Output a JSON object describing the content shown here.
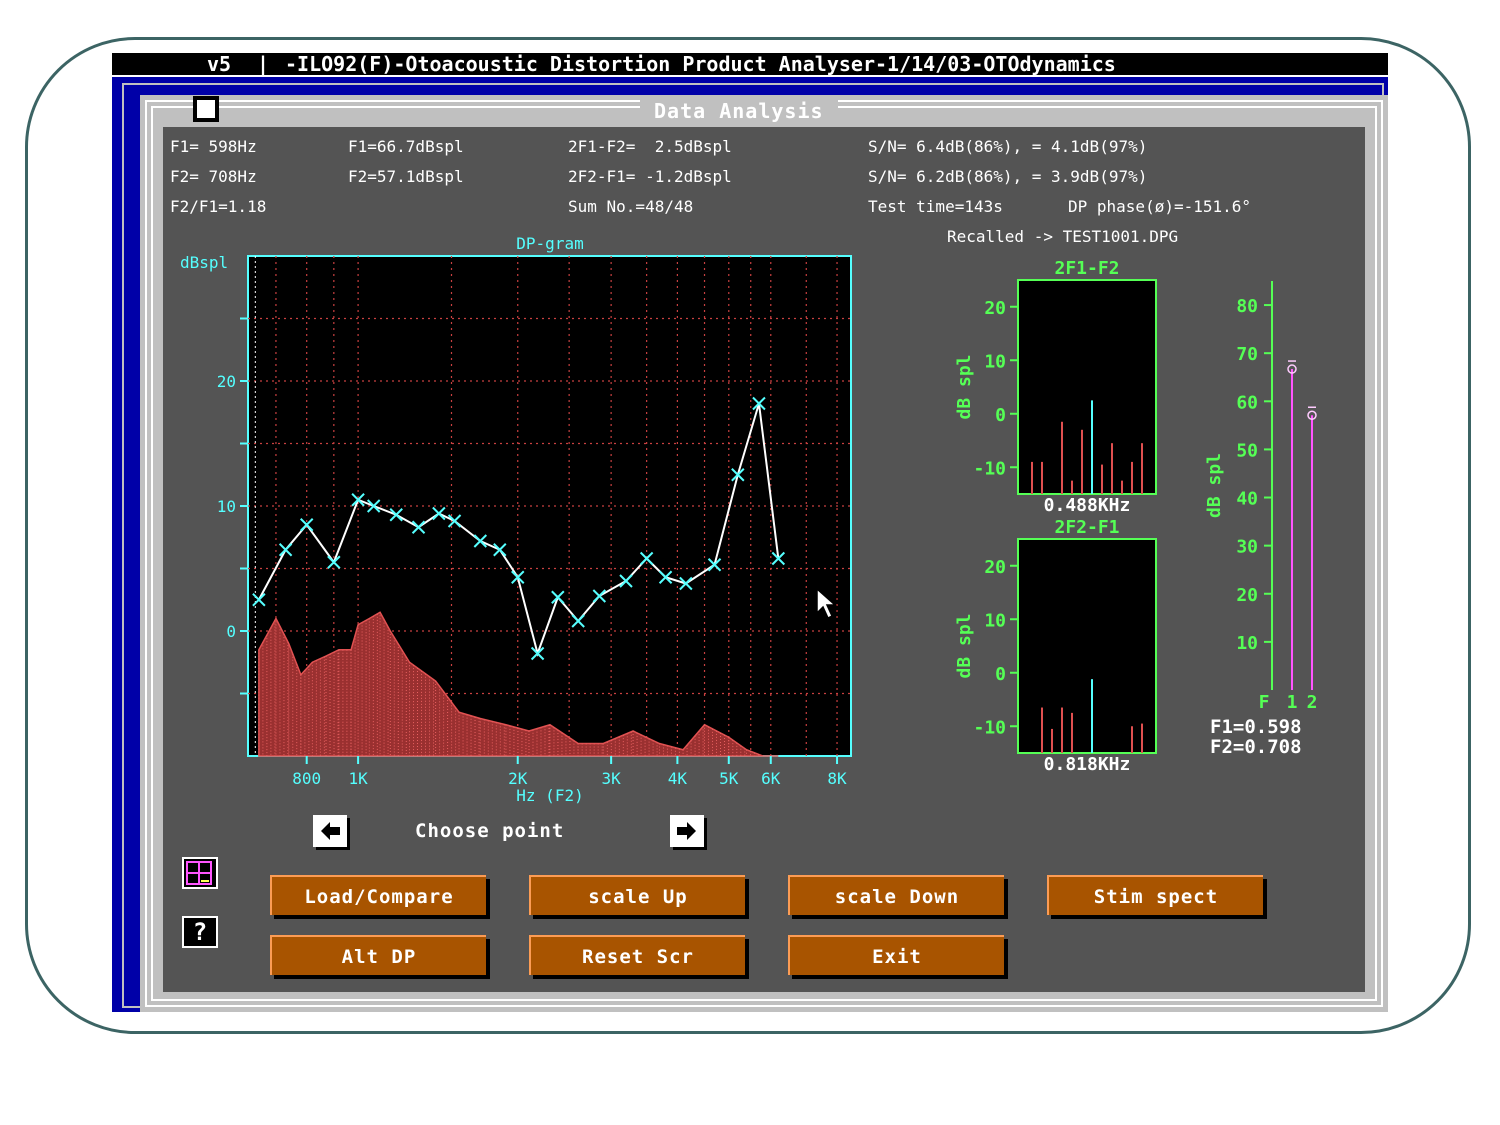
{
  "window_title": {
    "version": "v5",
    "separator": "|",
    "text": "-ILO92(F)-Otoacoustic Distortion Product Analyser-1/14/03-OTOdynamics"
  },
  "dialog_title": "Data Analysis",
  "info": {
    "f1_freq": "F1= 598Hz",
    "f2_freq": "F2= 708Hz",
    "ratio": "F2/F1=1.18",
    "f1_level": "F1=66.7dBspl",
    "f2_level": "F2=57.1dBspl",
    "dp1": "2F1-F2=  2.5dBspl",
    "dp2": "2F2-F1= -1.2dBspl",
    "sum": "Sum No.=48/48",
    "sn1": "S/N= 6.4dB(86%), = 4.1dB(97%)",
    "sn2": "S/N= 6.2dB(86%), = 3.9dB(97%)",
    "test_time": "Test time=143s",
    "dp_phase": "DP phase(ø)=-151.6°",
    "recalled": "Recalled -> TEST1001.DPG"
  },
  "chart_data": [
    {
      "type": "line",
      "title": "DP-gram",
      "ylabel": "dBspl",
      "xlabel": "Hz (F2)",
      "x_scale": "log",
      "x_ticks": [
        "800",
        "1K",
        "2K",
        "3K",
        "4K",
        "5K",
        "6K",
        "8K"
      ],
      "y_ticks": [
        "20",
        "10",
        "0"
      ],
      "ylim": [
        -10,
        30
      ],
      "xlim": [
        620,
        8500
      ],
      "grid": true,
      "series": [
        {
          "color": "#ffffff",
          "marker_color": "#55ffff",
          "x": [
            650,
            730,
            800,
            900,
            1000,
            1070,
            1180,
            1300,
            1420,
            1520,
            1700,
            1850,
            2000,
            2180,
            2380,
            2600,
            2850,
            3200,
            3500,
            3800,
            4150,
            4700,
            5200,
            5700,
            6200
          ],
          "y": [
            2.5,
            6.5,
            8.5,
            5.5,
            10.5,
            10.0,
            9.3,
            8.3,
            9.4,
            8.8,
            7.2,
            6.5,
            4.3,
            -1.8,
            2.7,
            0.8,
            2.8,
            4.0,
            5.8,
            4.3,
            3.8,
            5.3,
            12.5,
            18.2,
            5.8
          ]
        },
        {
          "role": "noise floor",
          "color": "#e05050",
          "x": [
            650,
            700,
            740,
            780,
            820,
            870,
            920,
            970,
            1000,
            1050,
            1100,
            1150,
            1250,
            1400,
            1550,
            1700,
            1900,
            2100,
            2300,
            2600,
            2900,
            3300,
            3700,
            4100,
            4500,
            5000,
            5400,
            5800,
            6200
          ],
          "y": [
            -1.5,
            1.0,
            -1.0,
            -3.5,
            -2.5,
            -2.0,
            -1.5,
            -1.5,
            0.5,
            1.0,
            1.5,
            0.0,
            -2.5,
            -4.0,
            -6.5,
            -7.0,
            -7.5,
            -8.0,
            -7.5,
            -9.0,
            -9.0,
            -8.0,
            -9.0,
            -9.5,
            -7.5,
            -8.5,
            -9.5,
            -10.0,
            -10.0
          ]
        }
      ]
    },
    {
      "type": "bar",
      "title": "2F1-F2",
      "ylabel": "dB spl",
      "xlabel": "0.488KHz",
      "ylim": [
        -15,
        25
      ],
      "y_ticks": [
        "20",
        "10",
        "0",
        "-10"
      ],
      "values": [
        -9.0,
        -9.0,
        -15.0,
        -1.5,
        -12.5,
        -3.0,
        2.5,
        -9.5,
        -5.5,
        -12.5,
        -9.0,
        -5.5
      ],
      "highlight_index": 6,
      "bar_color": "#e05050",
      "highlight_color": "#55ffff"
    },
    {
      "type": "bar",
      "title": "2F2-F1",
      "ylabel": "dB spl",
      "xlabel": "0.818KHz",
      "ylim": [
        -15,
        25
      ],
      "y_ticks": [
        "20",
        "10",
        "0",
        "-10"
      ],
      "values": [
        -15.0,
        -6.5,
        -10.5,
        -6.5,
        -7.5,
        -15.0,
        -1.2,
        -15.0,
        -15.0,
        -15.0,
        -10.0,
        -9.5
      ],
      "highlight_index": 6,
      "bar_color": "#e05050",
      "highlight_color": "#55ffff"
    },
    {
      "type": "bar",
      "ylabel": "dB spl",
      "ylim": [
        0,
        85
      ],
      "y_ticks": [
        "80",
        "70",
        "60",
        "50",
        "40",
        "30",
        "20",
        "10"
      ],
      "categories": [
        "1",
        "2"
      ],
      "values": [
        66.7,
        57.1
      ],
      "bar_color": "#ff55ff",
      "axis_label": "F"
    }
  ],
  "stim_readout": {
    "f1": "F1=0.598",
    "f2": "F2=0.708"
  },
  "choose_point_label": "Choose point",
  "buttons": {
    "load_compare": "Load/Compare",
    "scale_up": "scale Up",
    "scale_down": "scale Down",
    "stim_spect": "Stim spect",
    "alt_dp": "Alt DP",
    "reset_scr": "Reset Scr",
    "exit": "Exit"
  },
  "icons": {
    "help": "?"
  },
  "colors": {
    "window_bg": "#545454",
    "desktop_blue": "#0000a8",
    "button": "#a85400",
    "cyan": "#55ffff",
    "green": "#55ff55",
    "red": "#e05050",
    "magenta": "#ff55ff"
  }
}
